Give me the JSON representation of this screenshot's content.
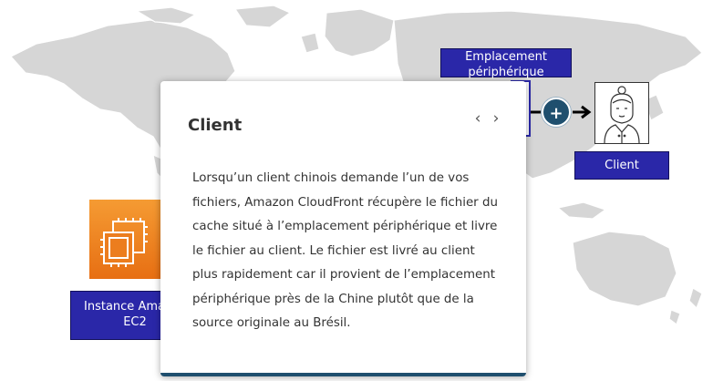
{
  "labels": {
    "edge_location": "Emplacement périphérique",
    "client": "Client",
    "ec2": "Instance Amazon EC2"
  },
  "icons": {
    "plus": "+",
    "prev": "‹",
    "next": "›"
  },
  "card": {
    "title": "Client",
    "body": "Lorsqu’un client chinois demande l’un de vos fichiers, Amazon CloudFront récupère le fichier du cache situé à l’emplacement périphérique et livre le fichier au client. Le fichier est livré au client plus rapidement car il provient de l’emplacement périphérique près de la Chine plutôt que de la source originale au Brésil."
  },
  "colors": {
    "label_bg": "#2a27a8",
    "map": "#d5d5d5",
    "accent": "#1f4f6e",
    "ec2_orange": "#f08a24"
  }
}
